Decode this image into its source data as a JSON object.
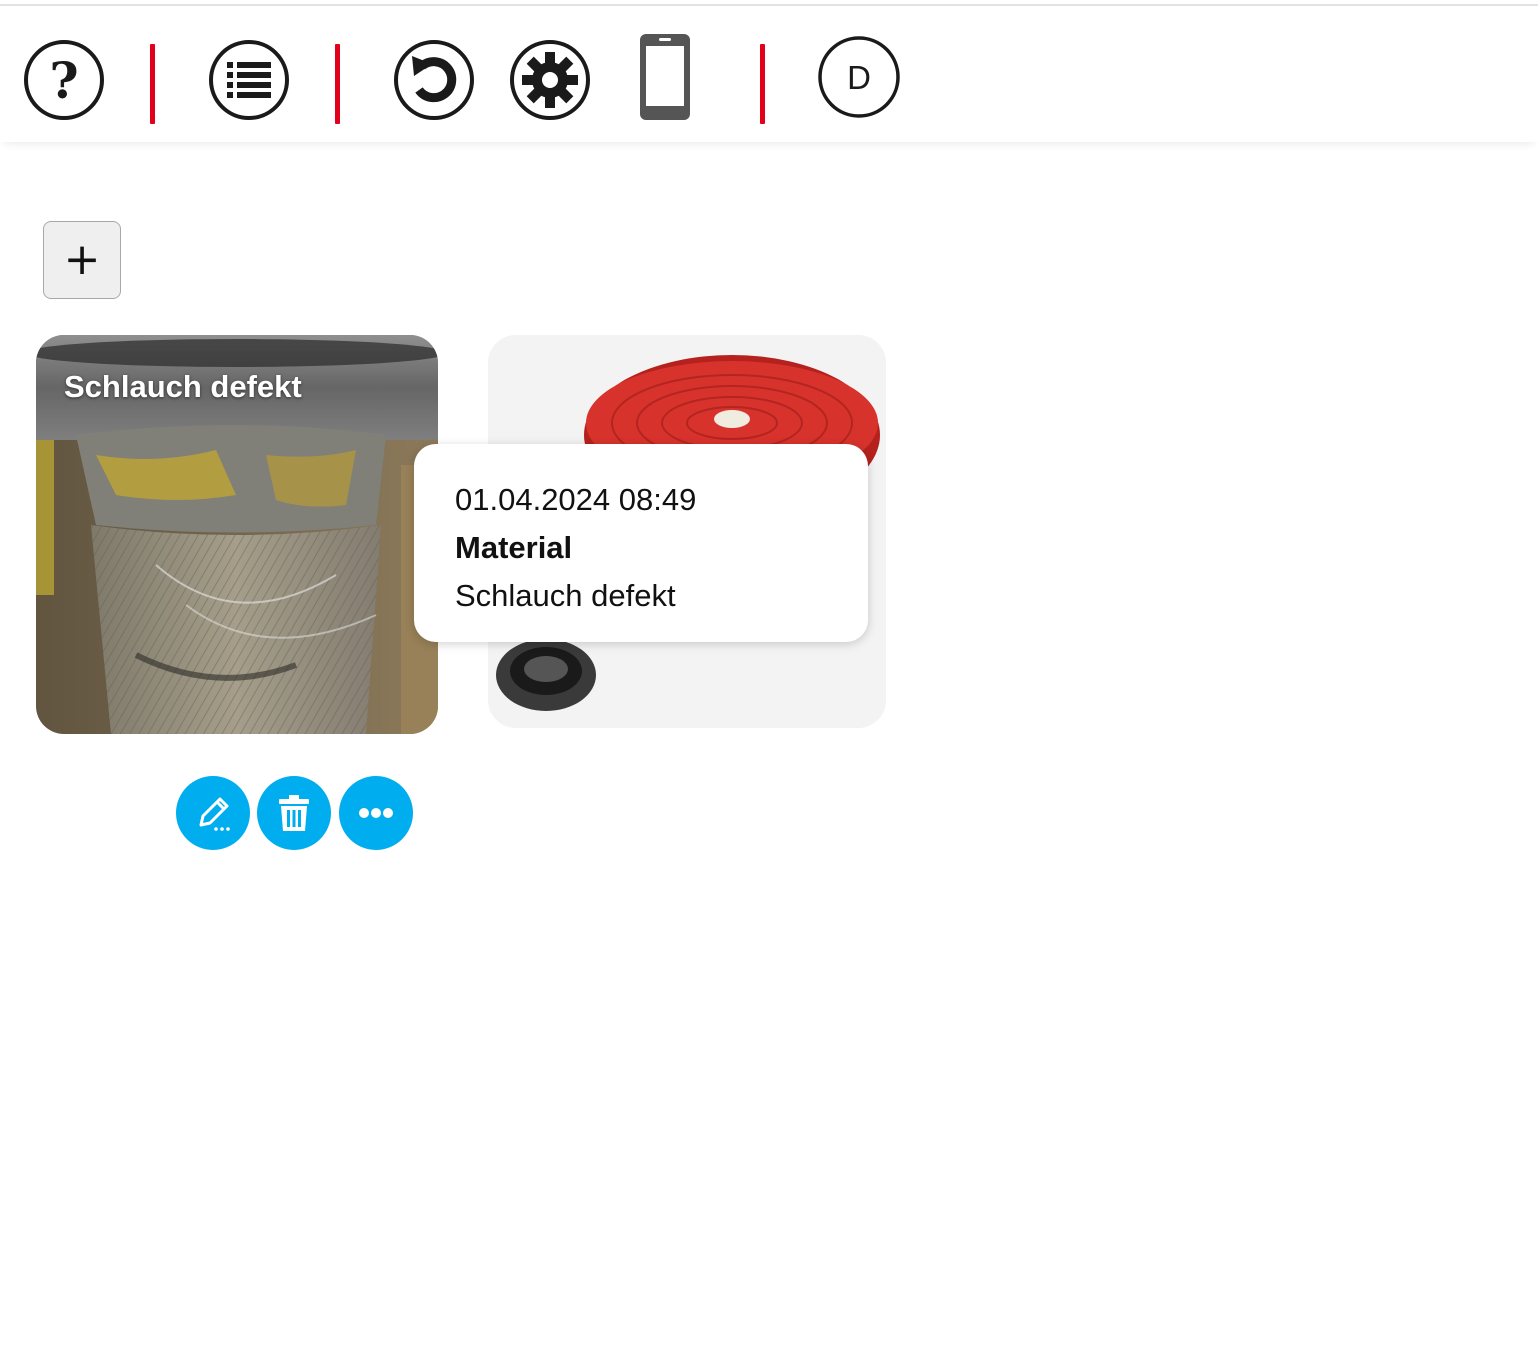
{
  "toolbar": {
    "icons": [
      "help-icon",
      "list-icon",
      "refresh-icon",
      "settings-icon",
      "mobile-icon"
    ],
    "user_initial": "D",
    "separator_color": "#e3001b"
  },
  "main": {
    "add_button_label": "+",
    "cards": [
      {
        "title": "Schlauch defekt",
        "image": "worn-hose-coupling-photo"
      },
      {
        "title": "",
        "image": "red-rolled-fire-hose-photo"
      }
    ],
    "tooltip": {
      "datetime": "01.04.2024 08:49",
      "category": "Material",
      "description": "Schlauch defekt"
    },
    "actions": [
      "edit-icon",
      "delete-icon",
      "more-icon"
    ],
    "action_color": "#00adef"
  }
}
